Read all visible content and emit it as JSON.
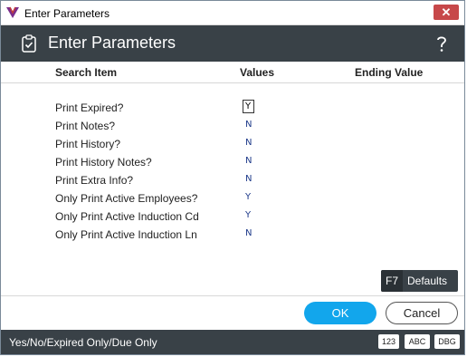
{
  "window": {
    "os_title": "Enter Parameters"
  },
  "header": {
    "title": "Enter Parameters"
  },
  "columns": {
    "search_item": "Search Item",
    "values": "Values",
    "ending_value": "Ending Value"
  },
  "rows": [
    {
      "label": "Print Expired?",
      "value": "Y"
    },
    {
      "label": "Print Notes?",
      "value": "N"
    },
    {
      "label": "Print History?",
      "value": "N"
    },
    {
      "label": "Print History Notes?",
      "value": "N"
    },
    {
      "label": "Print Extra Info?",
      "value": "N"
    },
    {
      "label": "Only Print Active Employees?",
      "value": "Y"
    },
    {
      "label": "Only Print Active Induction Cd",
      "value": "Y"
    },
    {
      "label": "Only Print Active Induction Ln",
      "value": "N"
    }
  ],
  "defaults": {
    "key": "F7",
    "label": "Defaults"
  },
  "buttons": {
    "ok": "OK",
    "cancel": "Cancel"
  },
  "status": {
    "hint": "Yes/No/Expired Only/Due Only",
    "modes": [
      "123",
      "ABC",
      "DBG"
    ]
  },
  "colors": {
    "header_bg": "#394147",
    "ok_bg": "#12a6ec",
    "close_bg": "#c7484a",
    "value_text": "#1e3a8a"
  },
  "icons": {
    "app_logo": "app-logo-icon",
    "close": "close-icon",
    "header": "clipboard-check-icon",
    "help": "help-icon"
  }
}
